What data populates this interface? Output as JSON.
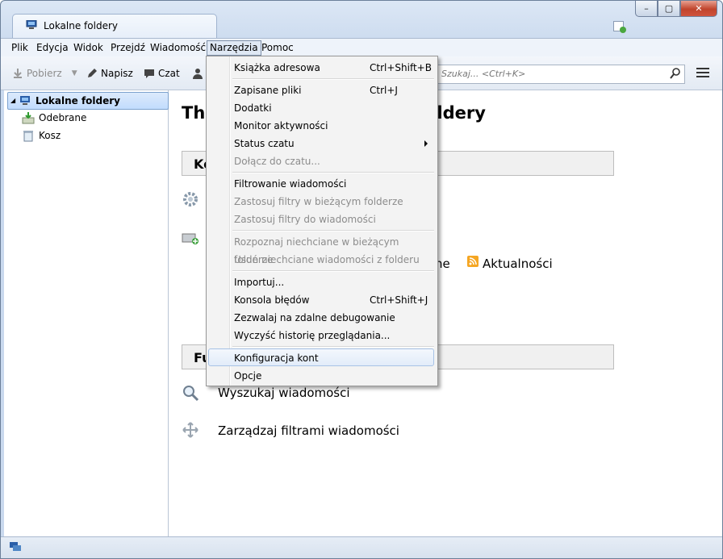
{
  "window": {
    "tab_title": "Lokalne foldery",
    "controls": {
      "minimize": "–",
      "maximize": "▢",
      "close": "✕"
    }
  },
  "menubar": {
    "items": [
      "Plik",
      "Edycja",
      "Widok",
      "Przejdź",
      "Wiadomość",
      "Narzędzia",
      "Pomoc"
    ],
    "active": "Narzędzia"
  },
  "toolbar": {
    "get_label": "Pobierz",
    "write_label": "Napisz",
    "chat_label": "Czat",
    "search_placeholder": "Szukaj... <Ctrl+K>"
  },
  "sidebar": {
    "root": "Lokalne foldery",
    "children": [
      "Odebrane",
      "Kosz"
    ]
  },
  "main": {
    "heading_left": "Thu",
    "heading_right": "oldery",
    "section1_prefix": "Ko",
    "section2_prefix": "Fu",
    "partial_text": "ne",
    "feeds_link": "Aktualności",
    "search_link": "Wyszukaj wiadomości",
    "filters_link": "Zarządzaj filtrami wiadomości"
  },
  "tools_menu": {
    "items": [
      {
        "label": "Książka adresowa",
        "shortcut": "Ctrl+Shift+B",
        "enabled": true
      },
      {
        "label": "Zapisane pliki",
        "shortcut": "Ctrl+J",
        "enabled": true
      },
      {
        "label": "Dodatki",
        "shortcut": "",
        "enabled": true
      },
      {
        "label": "Monitor aktywności",
        "shortcut": "",
        "enabled": true
      },
      {
        "label": "Status czatu",
        "shortcut": "",
        "enabled": true,
        "submenu": true
      },
      {
        "label": "Dołącz do czatu...",
        "shortcut": "",
        "enabled": false
      },
      {
        "label": "Filtrowanie wiadomości",
        "shortcut": "",
        "enabled": true
      },
      {
        "label": "Zastosuj filtry w bieżącym folderze",
        "shortcut": "",
        "enabled": false
      },
      {
        "label": "Zastosuj filtry do wiadomości",
        "shortcut": "",
        "enabled": false
      },
      {
        "label": "Rozpoznaj niechciane w bieżącym folderze",
        "shortcut": "",
        "enabled": false
      },
      {
        "label": "Usuń niechciane wiadomości z folderu",
        "shortcut": "",
        "enabled": false
      },
      {
        "label": "Importuj...",
        "shortcut": "",
        "enabled": true
      },
      {
        "label": "Konsola błędów",
        "shortcut": "Ctrl+Shift+J",
        "enabled": true
      },
      {
        "label": "Zezwalaj na zdalne debugowanie",
        "shortcut": "",
        "enabled": true
      },
      {
        "label": "Wyczyść historię przeglądania...",
        "shortcut": "",
        "enabled": true
      },
      {
        "label": "Konfiguracja kont",
        "shortcut": "",
        "enabled": true,
        "highlighted": true
      },
      {
        "label": "Opcje",
        "shortcut": "",
        "enabled": true
      }
    ]
  }
}
